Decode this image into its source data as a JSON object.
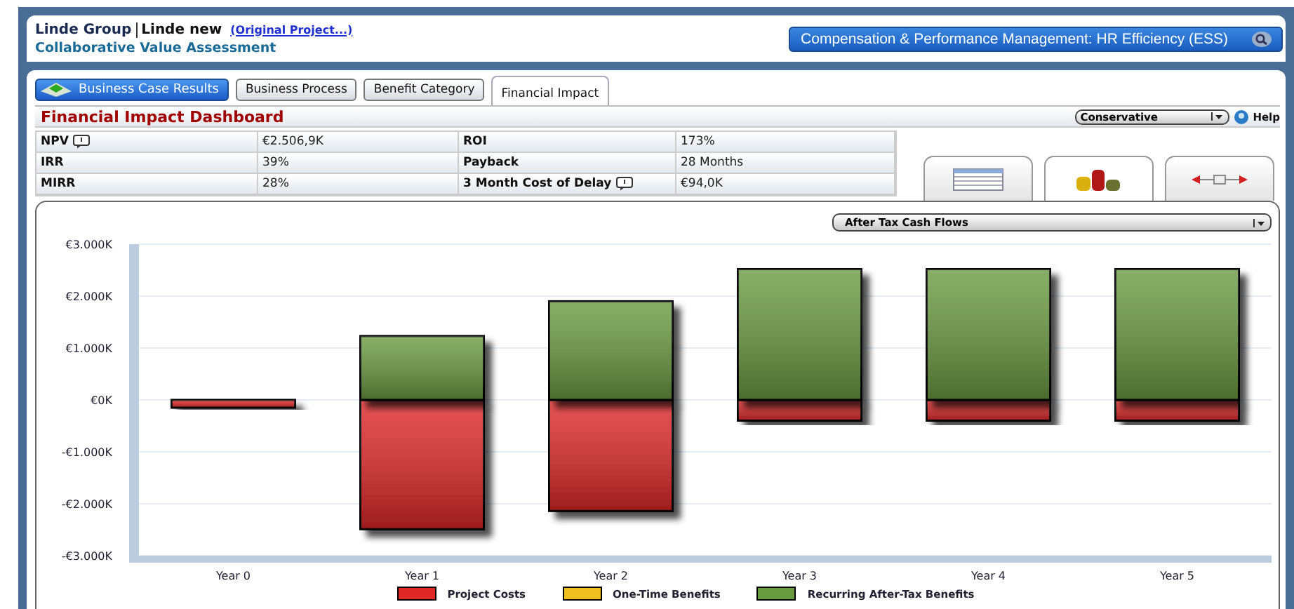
{
  "header": {
    "company": "Linde Group",
    "project": "Linde new",
    "original_link": "(Original Project...)",
    "subtitle": "Collaborative Value Assessment"
  },
  "context_button": "Compensation & Performance Management: HR Efficiency (ESS)",
  "home_button": "Business Case Results",
  "tabs": [
    {
      "label": "Business Process",
      "selected": false
    },
    {
      "label": "Benefit Category",
      "selected": false
    },
    {
      "label": "Financial Impact",
      "selected": true
    }
  ],
  "dashboard_title": "Financial Impact Dashboard",
  "scenario": "Conservative",
  "help": "Help",
  "metrics": [
    [
      {
        "label": "NPV",
        "comment": true,
        "value": "€2.506,9K"
      },
      {
        "label": "ROI",
        "comment": false,
        "value": "173%"
      }
    ],
    [
      {
        "label": "IRR",
        "comment": false,
        "value": "39%"
      },
      {
        "label": "Payback",
        "comment": false,
        "value": "28 Months"
      }
    ],
    [
      {
        "label": "MIRR",
        "comment": false,
        "value": "28%"
      },
      {
        "label": "3 Month Cost of Delay",
        "comment": true,
        "value": "€94,0K"
      }
    ]
  ],
  "view_tabs": [
    {
      "kind": "table",
      "selected": false
    },
    {
      "kind": "chart",
      "selected": true
    },
    {
      "kind": "slider",
      "selected": false
    }
  ],
  "chart": {
    "selector": "After Tax Cash Flows",
    "chart_data": {
      "type": "bar",
      "stacked": true,
      "grid": true,
      "categories": [
        "Year 0",
        "Year 1",
        "Year 2",
        "Year 3",
        "Year 4",
        "Year 5"
      ],
      "series": [
        {
          "name": "Project Costs",
          "color": "#e02828",
          "values": [
            -150,
            -2490,
            -2140,
            -400,
            -400,
            -400
          ]
        },
        {
          "name": "One-Time Benefits",
          "color": "#f0c020",
          "values": [
            0,
            0,
            0,
            0,
            0,
            0
          ]
        },
        {
          "name": "Recurring After-Tax Benefits",
          "color": "#6a9a40",
          "values": [
            0,
            1230,
            1900,
            2520,
            2520,
            2520
          ]
        }
      ],
      "ylim": [
        -3000,
        3000
      ],
      "yticks": [
        {
          "value": 3000,
          "label": "€3.000K"
        },
        {
          "value": 2000,
          "label": "€2.000K"
        },
        {
          "value": 1000,
          "label": "€1.000K"
        },
        {
          "value": 0,
          "label": "€0K"
        },
        {
          "value": -1000,
          "label": "-€1.000K"
        },
        {
          "value": -2000,
          "label": "-€2.000K"
        },
        {
          "value": -3000,
          "label": "-€3.000K"
        }
      ]
    }
  }
}
